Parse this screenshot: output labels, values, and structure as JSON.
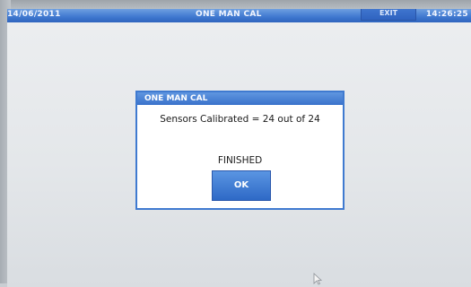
{
  "header": {
    "date": "14/06/2011",
    "title": "ONE MAN CAL",
    "time": "14:26:25",
    "exit_label": "EXIT"
  },
  "dialog": {
    "title": "ONE MAN CAL",
    "message": "Sensors Calibrated = 24 out of 24",
    "status": "FINISHED",
    "ok_label": "OK"
  },
  "colors": {
    "accent": "#3f78cf",
    "screen_bg": "#e4e7ea"
  }
}
